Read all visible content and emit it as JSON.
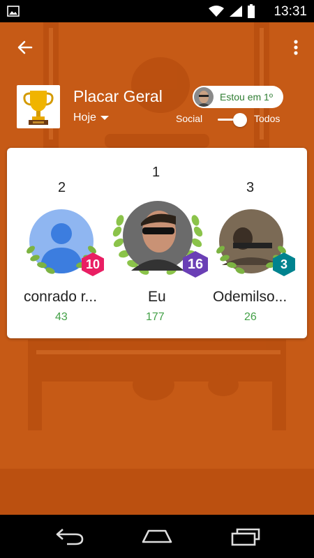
{
  "status_bar": {
    "time": "13:31",
    "icons": [
      "gallery-icon",
      "wifi-icon",
      "signal-icon",
      "battery-icon"
    ]
  },
  "header": {
    "title": "Placar Geral",
    "filter_label": "Hoje",
    "position_pill": "Estou em 1º",
    "toggle_left": "Social",
    "toggle_right": "Todos",
    "toggle_state": "Todos"
  },
  "podium": {
    "first": {
      "rank": "1",
      "name": "Eu",
      "score": "177",
      "level": "16"
    },
    "second": {
      "rank": "2",
      "name": "conrado r...",
      "score": "43",
      "level": "10"
    },
    "third": {
      "rank": "3",
      "name": "Odemilso...",
      "score": "26",
      "level": "3"
    }
  },
  "colors": {
    "background": "#c65a16",
    "score_green": "#43a047",
    "badge_pink": "#e91e63",
    "badge_purple": "#6a3fb5",
    "badge_teal": "#00838f",
    "laurel_green": "#8bc34a"
  },
  "nav_bar": {
    "icons": [
      "back-nav-icon",
      "home-nav-icon",
      "recents-nav-icon"
    ]
  }
}
